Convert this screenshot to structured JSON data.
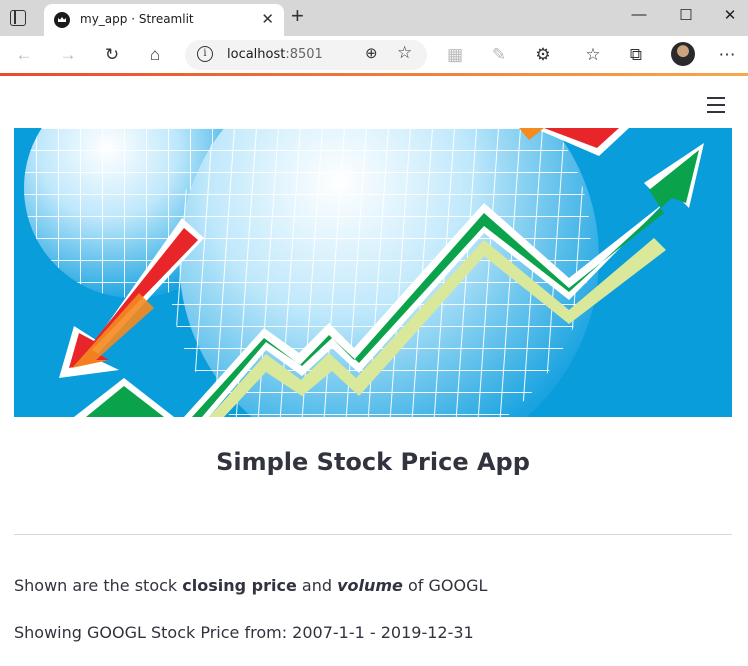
{
  "browser": {
    "tab_title": "my_app · Streamlit",
    "tab_close": "✕",
    "new_tab": "+",
    "window_controls": {
      "minimize": "—",
      "maximize": "☐",
      "close": "✕"
    },
    "address_host": "localhost",
    "address_port": ":8501",
    "icons": [
      "back-icon",
      "forward-icon",
      "refresh-icon",
      "home-icon",
      "info-icon",
      "zoom-icon",
      "favorite-add-icon",
      "reading-view-icon",
      "read-aloud-icon",
      "extensions-icon",
      "favorites-icon",
      "collections-icon",
      "profile-avatar",
      "more-icon"
    ]
  },
  "app": {
    "title": "Simple Stock Price App",
    "intro": {
      "prefix": "Shown are the stock ",
      "bold": "closing price",
      "middle": " and ",
      "bold_italic": "volume",
      "suffix": " of GOOGL"
    },
    "range_text": "Showing GOOGL Stock Price from: 2007-1-1 - 2019-12-31"
  },
  "colors": {
    "banner_bg": "#0a9ddb",
    "arrow_up": "#0aa24a",
    "arrow_up_inner": "#d9e89a",
    "arrow_down": "#e8262a",
    "arrow_down_inner": "#f58a1f",
    "text": "#31333f"
  }
}
